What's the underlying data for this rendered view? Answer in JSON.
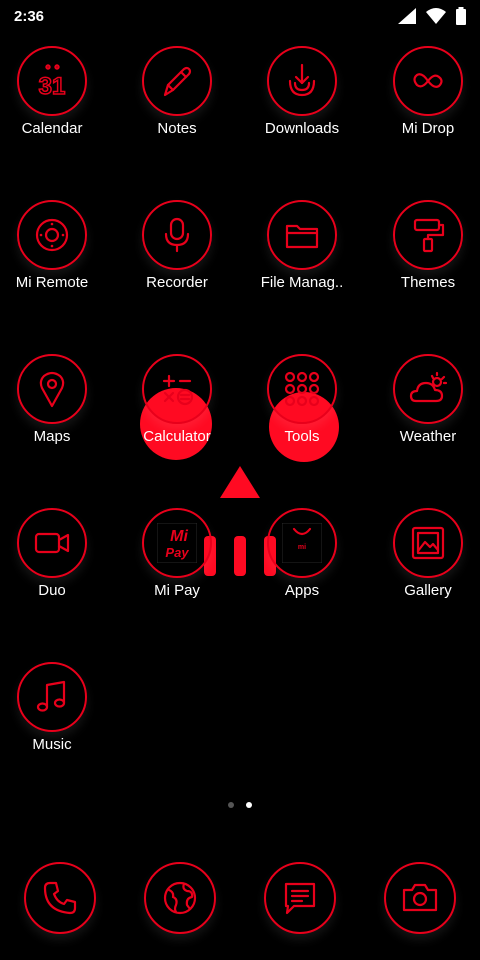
{
  "status_bar": {
    "time": "2:36"
  },
  "apps": [
    {
      "label": "Calendar",
      "icon": "calendar-icon",
      "cal_text": "31"
    },
    {
      "label": "Notes",
      "icon": "notes-icon"
    },
    {
      "label": "Downloads",
      "icon": "downloads-icon"
    },
    {
      "label": "Mi Drop",
      "icon": "mi-drop-icon"
    },
    {
      "label": "Mi Remote",
      "icon": "remote-icon"
    },
    {
      "label": "Recorder",
      "icon": "mic-icon"
    },
    {
      "label": "File Manag..",
      "icon": "folder-icon"
    },
    {
      "label": "Themes",
      "icon": "paint-roller-icon"
    },
    {
      "label": "Maps",
      "icon": "map-pin-icon"
    },
    {
      "label": "Calculator",
      "icon": "calculator-icon"
    },
    {
      "label": "Tools",
      "icon": "tools-folder-icon"
    },
    {
      "label": "Weather",
      "icon": "weather-icon"
    },
    {
      "label": "Duo",
      "icon": "video-camera-icon"
    },
    {
      "label": "Mi Pay",
      "icon": "mi-pay-icon",
      "mi_text": "Mi",
      "pay_text": "Pay"
    },
    {
      "label": "Apps",
      "icon": "shopping-bag-icon",
      "bag_text": "mi"
    },
    {
      "label": "Gallery",
      "icon": "gallery-icon"
    },
    {
      "label": "Music",
      "icon": "music-note-icon"
    }
  ],
  "page_indicator": {
    "count": 2,
    "active": 1
  },
  "dock": [
    {
      "icon": "phone-icon"
    },
    {
      "icon": "globe-icon"
    },
    {
      "icon": "message-icon"
    },
    {
      "icon": "camera-icon"
    }
  ],
  "colors": {
    "accent": "#e8001b",
    "background": "#000000"
  }
}
